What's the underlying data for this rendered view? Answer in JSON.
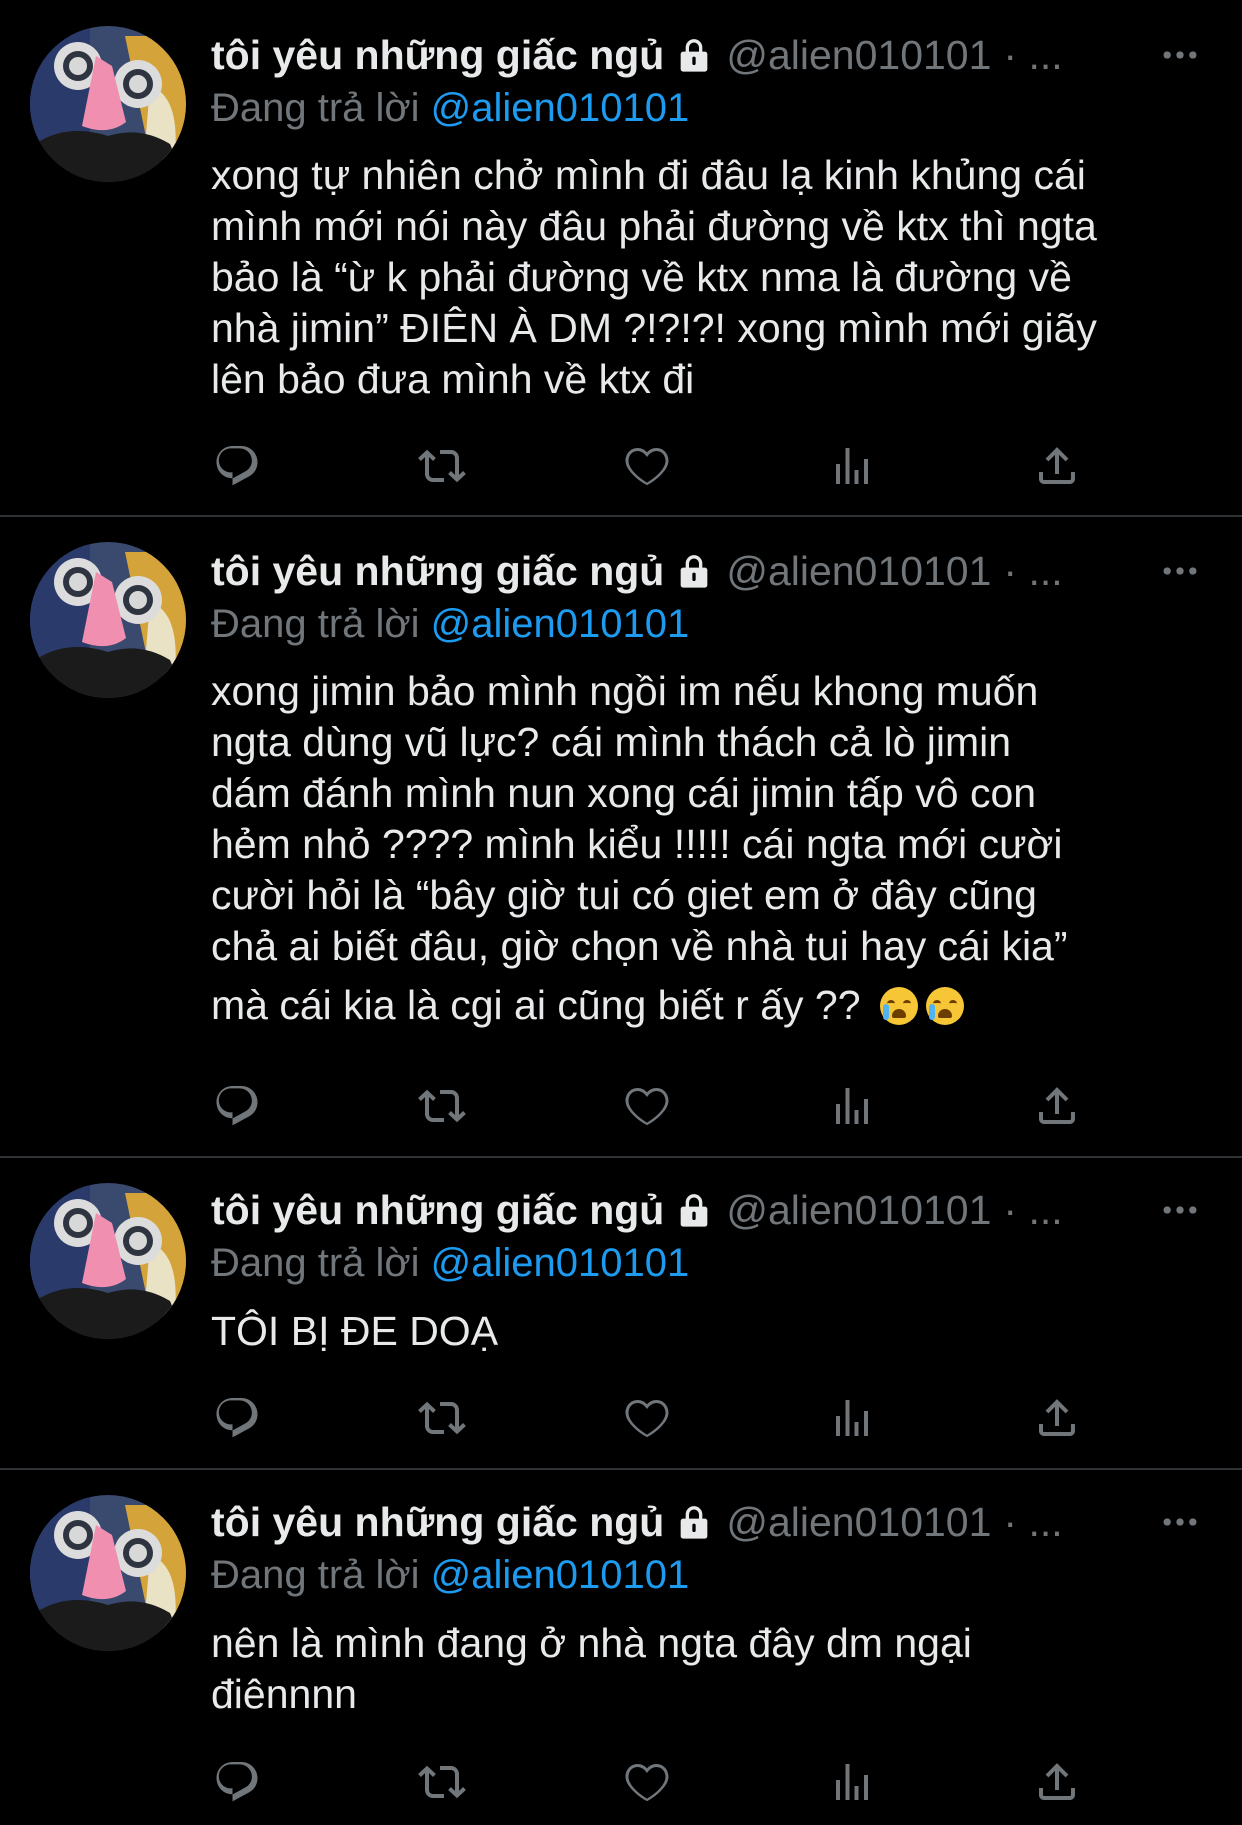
{
  "tweets": [
    {
      "name": "tôi yêu những giấc ngủ",
      "handle": "@alien010101",
      "sep": "· ...",
      "replying_prefix": "Đang trả lời",
      "replying_to": "@alien010101",
      "lines": [
        "xong tự nhiên chở mình đi đâu lạ kinh khủng cái",
        "mình mới nói này đâu phải đường về ktx thì ngta",
        "bảo là “ừ k phải đường về ktx nma là đường về",
        "nhà jimin” ĐIÊN À DM ?!?!?! xong mình mới giãy",
        "lên bảo đưa mình về ktx đi"
      ]
    },
    {
      "name": "tôi yêu những giấc ngủ",
      "handle": "@alien010101",
      "sep": "· ...",
      "replying_prefix": "Đang trả lời",
      "replying_to": "@alien010101",
      "lines": [
        "xong jimin bảo mình ngồi im nếu khong muốn",
        "ngta dùng vũ lực? cái mình thách cả lò jimin",
        "dám đánh mình nun xong cái jimin tấp vô con",
        "hẻm nhỏ ???? mình kiểu !!!!! cái ngta mới cười",
        "cười hỏi là “bây giờ tui có giet em ở đây cũng",
        "chả ai biết đâu, giờ chọn về nhà tui hay cái kia”",
        "mà cái kia là cgi ai cũng biết r ấy ??"
      ]
    },
    {
      "name": "tôi yêu những giấc ngủ",
      "handle": "@alien010101",
      "sep": "· ...",
      "replying_prefix": "Đang trả lời",
      "replying_to": "@alien010101",
      "lines": [
        "TÔI BỊ ĐE DOẠ"
      ]
    },
    {
      "name": "tôi yêu những giấc ngủ",
      "handle": "@alien010101",
      "sep": "· ...",
      "replying_prefix": "Đang trả lời",
      "replying_to": "@alien010101",
      "lines": [
        "nên là mình đang ở nhà ngta đây dm ngại",
        "điênnnn"
      ]
    }
  ],
  "icons": {
    "reply": "reply-icon",
    "retweet": "retweet-icon",
    "like": "heart-icon",
    "views": "views-icon",
    "share": "share-icon",
    "more": "more-icon",
    "lock": "lock-icon",
    "emoji": "loudly-crying-face-emoji"
  },
  "colors": {
    "background": "#000000",
    "text": "#e7e9ea",
    "muted": "#71767b",
    "link": "#1d9bf0",
    "divider": "#2f3336"
  }
}
